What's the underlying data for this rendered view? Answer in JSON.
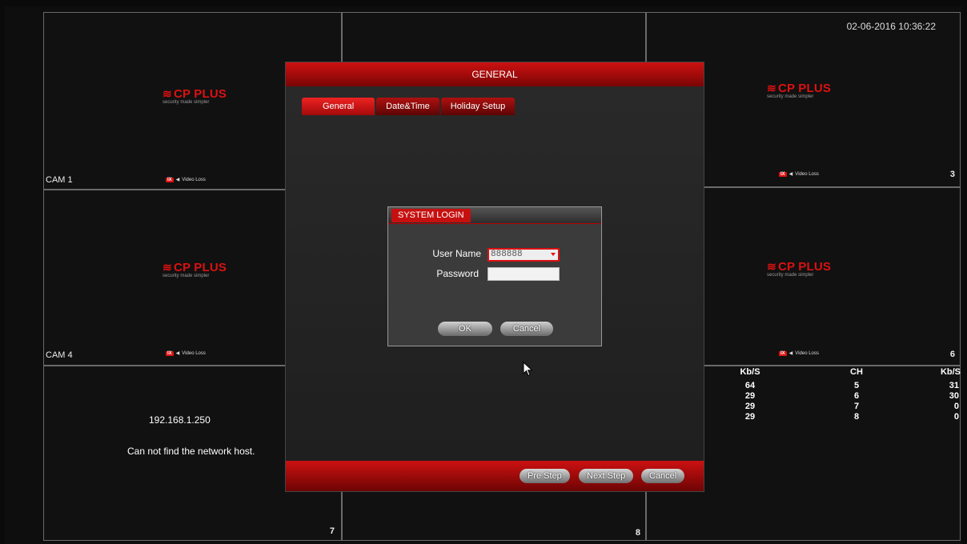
{
  "datetime": "02-06-2016 10:36:22",
  "brand": {
    "name": "CP PLUS",
    "symbol": "≋",
    "tagline": "security made simpler"
  },
  "video_loss": {
    "icon_text": "IX",
    "label": "Video Loss"
  },
  "cameras": {
    "cam1": {
      "label": "CAM 1"
    },
    "cam3": {
      "number": "3"
    },
    "cam4": {
      "label": "CAM 4"
    },
    "cam6": {
      "number": "6"
    },
    "cam7": {
      "number": "7",
      "ip": "192.168.1.250",
      "message": "Can not find the network host."
    },
    "cam8": {
      "number": "8"
    }
  },
  "bitrate": {
    "headers": [
      "Kb/S",
      "CH",
      "Kb/S"
    ],
    "rows": [
      [
        "64",
        "5",
        "31"
      ],
      [
        "29",
        "6",
        "30"
      ],
      [
        "29",
        "7",
        "0"
      ],
      [
        "29",
        "8",
        "0"
      ]
    ]
  },
  "general_dialog": {
    "title": "GENERAL",
    "tabs": [
      "General",
      "Date&Time",
      "Holiday Setup"
    ],
    "footer_buttons": {
      "pre_step": "Pre Step",
      "next_step": "Next Step",
      "cancel": "Cancel"
    }
  },
  "login_dialog": {
    "title": "SYSTEM LOGIN",
    "username_label": "User Name",
    "username_value": "888888",
    "password_label": "Password",
    "password_value": "",
    "ok": "OK",
    "cancel": "Cancel"
  },
  "colors": {
    "accent": "#cc1111",
    "background": "#0e0e0e"
  }
}
